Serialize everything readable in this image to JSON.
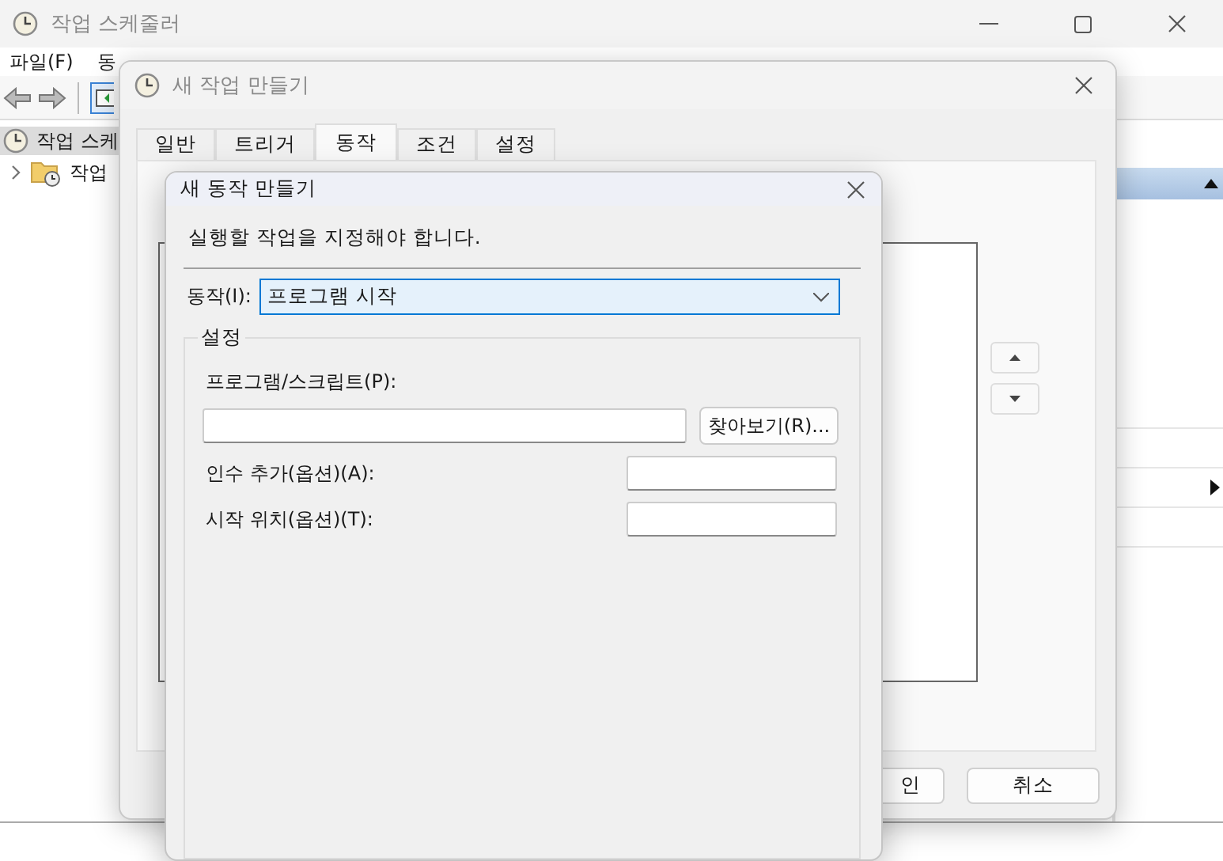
{
  "main_window": {
    "title": "작업 스케줄러",
    "menu": [
      "파일(F)",
      "동"
    ],
    "tree": [
      {
        "label": "작업 스케",
        "selected": true,
        "children": [
          {
            "label": "작업",
            "selected": false,
            "expanded": false
          }
        ]
      }
    ]
  },
  "task_dialog": {
    "title": "새 작업 만들기",
    "tabs": [
      {
        "label": "일반",
        "selected": false
      },
      {
        "label": "트리거",
        "selected": false
      },
      {
        "label": "동작",
        "selected": true
      },
      {
        "label": "조건",
        "selected": false
      },
      {
        "label": "설정",
        "selected": false
      }
    ],
    "buttons": [
      "인",
      "취소"
    ]
  },
  "action_dialog": {
    "title": "새 동작 만들기",
    "instruction": "실행할 작업을 지정해야 합니다.",
    "action_label": "동작(I):",
    "action_value": "프로그램 시작",
    "group_title": "설정",
    "program_label": "프로그램/스크립트(P):",
    "browse_button": "찾아보기(R)...",
    "fields": [
      {
        "label": "인수 추가(옵션)(A):"
      },
      {
        "label": "시작 위치(옵션)(T):"
      }
    ]
  }
}
